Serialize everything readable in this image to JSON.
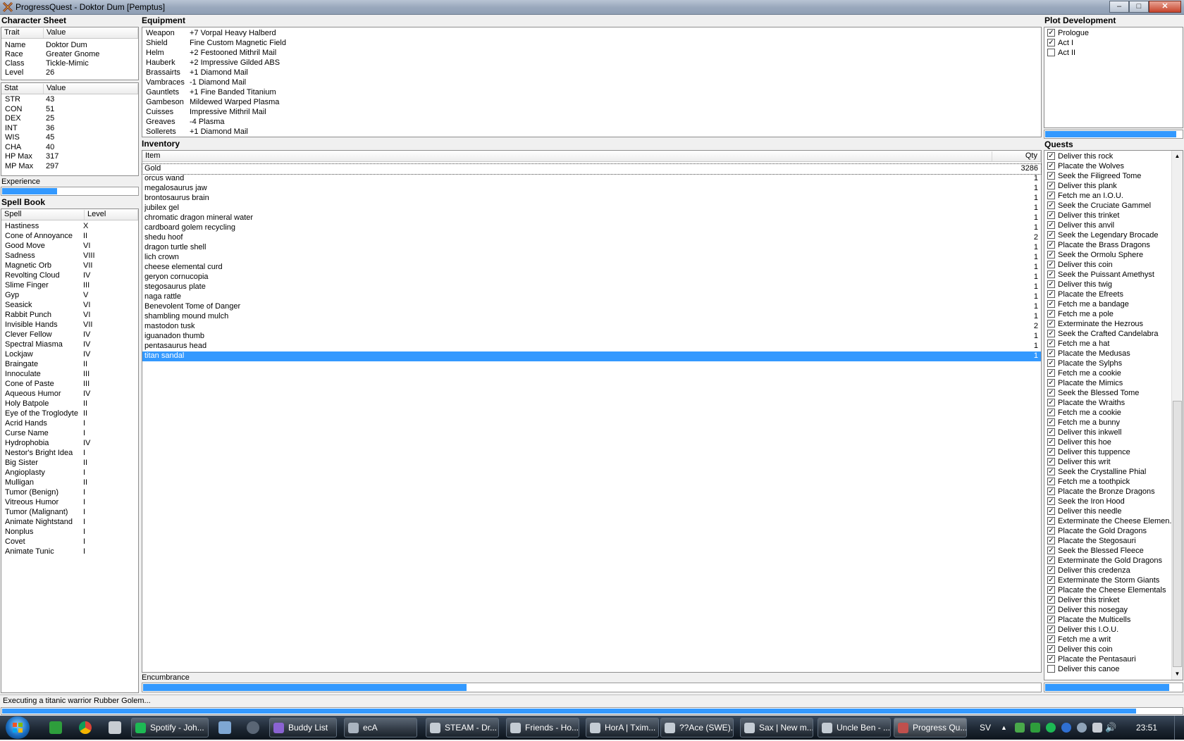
{
  "window": {
    "title": "ProgressQuest - Doktor Dum [Pemptus]",
    "minimize": "–",
    "maximize": "□",
    "close": "✕"
  },
  "character_sheet": {
    "title": "Character Sheet",
    "col_trait": "Trait",
    "col_value": "Value",
    "traits": [
      {
        "k": "Name",
        "v": "Doktor Dum"
      },
      {
        "k": "Race",
        "v": "Greater Gnome"
      },
      {
        "k": "Class",
        "v": "Tickle-Mimic"
      },
      {
        "k": "Level",
        "v": "26"
      }
    ],
    "col_stat": "Stat",
    "col_stat_value": "Value",
    "stats": [
      {
        "k": "STR",
        "v": "43"
      },
      {
        "k": "CON",
        "v": "51"
      },
      {
        "k": "DEX",
        "v": "25"
      },
      {
        "k": "INT",
        "v": "36"
      },
      {
        "k": "WIS",
        "v": "45"
      },
      {
        "k": "CHA",
        "v": "40"
      },
      {
        "k": "HP Max",
        "v": "317"
      },
      {
        "k": "MP Max",
        "v": "297"
      }
    ],
    "experience_label": "Experience",
    "experience_progress": 0.4
  },
  "spell_book": {
    "title": "Spell Book",
    "col_spell": "Spell",
    "col_level": "Level",
    "spells": [
      {
        "k": "Hastiness",
        "v": "X"
      },
      {
        "k": "Cone of Annoyance",
        "v": "II"
      },
      {
        "k": "Good Move",
        "v": "VI"
      },
      {
        "k": "Sadness",
        "v": "VIII"
      },
      {
        "k": "Magnetic Orb",
        "v": "VII"
      },
      {
        "k": "Revolting Cloud",
        "v": "IV"
      },
      {
        "k": "Slime Finger",
        "v": "III"
      },
      {
        "k": "Gyp",
        "v": "V"
      },
      {
        "k": "Seasick",
        "v": "VI"
      },
      {
        "k": "Rabbit Punch",
        "v": "VI"
      },
      {
        "k": "Invisible Hands",
        "v": "VII"
      },
      {
        "k": "Clever Fellow",
        "v": "IV"
      },
      {
        "k": "Spectral Miasma",
        "v": "IV"
      },
      {
        "k": "Lockjaw",
        "v": "IV"
      },
      {
        "k": "Braingate",
        "v": "II"
      },
      {
        "k": "Innoculate",
        "v": "III"
      },
      {
        "k": "Cone of Paste",
        "v": "III"
      },
      {
        "k": "Aqueous Humor",
        "v": "IV"
      },
      {
        "k": "Holy Batpole",
        "v": "II"
      },
      {
        "k": "Eye of the Troglodyte",
        "v": "II"
      },
      {
        "k": "Acrid Hands",
        "v": "I"
      },
      {
        "k": "Curse Name",
        "v": "I"
      },
      {
        "k": "Hydrophobia",
        "v": "IV"
      },
      {
        "k": "Nestor's Bright Idea",
        "v": "I"
      },
      {
        "k": "Big Sister",
        "v": "II"
      },
      {
        "k": "Angioplasty",
        "v": "I"
      },
      {
        "k": "Mulligan",
        "v": "II"
      },
      {
        "k": "Tumor (Benign)",
        "v": "I"
      },
      {
        "k": "Vitreous Humor",
        "v": "I"
      },
      {
        "k": "Tumor (Malignant)",
        "v": "I"
      },
      {
        "k": "Animate Nightstand",
        "v": "I"
      },
      {
        "k": "Nonplus",
        "v": "I"
      },
      {
        "k": "Covet",
        "v": "I"
      },
      {
        "k": "Animate Tunic",
        "v": "I"
      }
    ]
  },
  "equipment": {
    "title": "Equipment",
    "items": [
      {
        "k": "Weapon",
        "v": "+7 Vorpal Heavy Halberd"
      },
      {
        "k": "Shield",
        "v": "Fine Custom Magnetic Field"
      },
      {
        "k": "Helm",
        "v": "+2 Festooned Mithril Mail"
      },
      {
        "k": "Hauberk",
        "v": "+2 Impressive Gilded ABS"
      },
      {
        "k": "Brassairts",
        "v": "+1 Diamond Mail"
      },
      {
        "k": "Vambraces",
        "v": "-1 Diamond Mail"
      },
      {
        "k": "Gauntlets",
        "v": "+1 Fine Banded Titanium"
      },
      {
        "k": "Gambeson",
        "v": "Mildewed Warped Plasma"
      },
      {
        "k": "Cuisses",
        "v": "Impressive Mithril Mail"
      },
      {
        "k": "Greaves",
        "v": "-4 Plasma"
      },
      {
        "k": "Sollerets",
        "v": "+1 Diamond Mail"
      }
    ]
  },
  "inventory": {
    "title": "Inventory",
    "col_item": "Item",
    "col_qty": "Qty",
    "items": [
      {
        "k": "Gold",
        "v": "3286"
      },
      {
        "k": "orcus wand",
        "v": "1"
      },
      {
        "k": "megalosaurus jaw",
        "v": "1"
      },
      {
        "k": "brontosaurus brain",
        "v": "1"
      },
      {
        "k": "jubilex gel",
        "v": "1"
      },
      {
        "k": "chromatic dragon mineral water",
        "v": "1"
      },
      {
        "k": "cardboard golem recycling",
        "v": "1"
      },
      {
        "k": "shedu hoof",
        "v": "2"
      },
      {
        "k": "dragon turtle shell",
        "v": "1"
      },
      {
        "k": "lich crown",
        "v": "1"
      },
      {
        "k": "cheese elemental curd",
        "v": "1"
      },
      {
        "k": "geryon cornucopia",
        "v": "1"
      },
      {
        "k": "stegosaurus plate",
        "v": "1"
      },
      {
        "k": "naga rattle",
        "v": "1"
      },
      {
        "k": "Benevolent Tome of Danger",
        "v": "1"
      },
      {
        "k": "shambling mound mulch",
        "v": "1"
      },
      {
        "k": "mastodon tusk",
        "v": "2"
      },
      {
        "k": "iguanadon thumb",
        "v": "1"
      },
      {
        "k": "pentasaurus head",
        "v": "1"
      },
      {
        "k": "titan sandal",
        "v": "1"
      }
    ],
    "encumbrance_label": "Encumbrance",
    "encumbrance_progress": 0.36
  },
  "plot": {
    "title": "Plot Development",
    "acts": [
      {
        "k": "Prologue",
        "done": true
      },
      {
        "k": "Act I",
        "done": true
      },
      {
        "k": "Act II",
        "done": false
      }
    ],
    "progress": 0.95
  },
  "quests": {
    "title": "Quests",
    "items": [
      {
        "k": "Deliver this rock",
        "done": true
      },
      {
        "k": "Placate the Wolves",
        "done": true
      },
      {
        "k": "Seek the Filigreed Tome",
        "done": true
      },
      {
        "k": "Deliver this plank",
        "done": true
      },
      {
        "k": "Fetch me an I.O.U.",
        "done": true
      },
      {
        "k": "Seek the Cruciate Gammel",
        "done": true
      },
      {
        "k": "Deliver this trinket",
        "done": true
      },
      {
        "k": "Deliver this anvil",
        "done": true
      },
      {
        "k": "Seek the Legendary Brocade",
        "done": true
      },
      {
        "k": "Placate the Brass Dragons",
        "done": true
      },
      {
        "k": "Seek the Ormolu Sphere",
        "done": true
      },
      {
        "k": "Deliver this coin",
        "done": true
      },
      {
        "k": "Seek the Puissant Amethyst",
        "done": true
      },
      {
        "k": "Deliver this twig",
        "done": true
      },
      {
        "k": "Placate the Efreets",
        "done": true
      },
      {
        "k": "Fetch me a bandage",
        "done": true
      },
      {
        "k": "Fetch me a pole",
        "done": true
      },
      {
        "k": "Exterminate the Hezrous",
        "done": true
      },
      {
        "k": "Seek the Crafted Candelabra",
        "done": true
      },
      {
        "k": "Fetch me a hat",
        "done": true
      },
      {
        "k": "Placate the Medusas",
        "done": true
      },
      {
        "k": "Placate the Sylphs",
        "done": true
      },
      {
        "k": "Fetch me a cookie",
        "done": true
      },
      {
        "k": "Placate the Mimics",
        "done": true
      },
      {
        "k": "Seek the Blessed Tome",
        "done": true
      },
      {
        "k": "Placate the Wraiths",
        "done": true
      },
      {
        "k": "Fetch me a cookie",
        "done": true
      },
      {
        "k": "Fetch me a bunny",
        "done": true
      },
      {
        "k": "Deliver this inkwell",
        "done": true
      },
      {
        "k": "Deliver this hoe",
        "done": true
      },
      {
        "k": "Deliver this tuppence",
        "done": true
      },
      {
        "k": "Deliver this writ",
        "done": true
      },
      {
        "k": "Seek the Crystalline Phial",
        "done": true
      },
      {
        "k": "Fetch me a toothpick",
        "done": true
      },
      {
        "k": "Placate the Bronze Dragons",
        "done": true
      },
      {
        "k": "Seek the Iron Hood",
        "done": true
      },
      {
        "k": "Deliver this needle",
        "done": true
      },
      {
        "k": "Exterminate the Cheese Elemen...",
        "done": true
      },
      {
        "k": "Placate the Gold Dragons",
        "done": true
      },
      {
        "k": "Placate the Stegosauri",
        "done": true
      },
      {
        "k": "Seek the Blessed Fleece",
        "done": true
      },
      {
        "k": "Exterminate the Gold Dragons",
        "done": true
      },
      {
        "k": "Deliver this credenza",
        "done": true
      },
      {
        "k": "Exterminate the Storm Giants",
        "done": true
      },
      {
        "k": "Placate the Cheese Elementals",
        "done": true
      },
      {
        "k": "Deliver this trinket",
        "done": true
      },
      {
        "k": "Deliver this nosegay",
        "done": true
      },
      {
        "k": "Placate the Multicells",
        "done": true
      },
      {
        "k": "Deliver this I.O.U.",
        "done": true
      },
      {
        "k": "Fetch me a writ",
        "done": true
      },
      {
        "k": "Deliver this coin",
        "done": true
      },
      {
        "k": "Placate the Pentasauri",
        "done": true
      },
      {
        "k": "Deliver this canoe",
        "done": false
      }
    ],
    "progress": 0.9
  },
  "status": {
    "text": "Executing a titanic warrior Rubber Golem...",
    "progress": 0.96
  },
  "taskbar": {
    "buttons": [
      {
        "label": "Spotify - Joh...",
        "color": "#1db954",
        "icon": "spotify-icon"
      },
      {
        "label": "Buddy List",
        "color": "#8a63d2",
        "icon": "buddy-icon"
      },
      {
        "label": "ecA",
        "color": "#aab4c0",
        "icon": "chat-icon"
      },
      {
        "label": "STEAM - Dr...",
        "color": "#c4ccd4",
        "icon": "steam-icon"
      },
      {
        "label": "Friends - Ho...",
        "color": "#c4ccd4",
        "icon": "steam-icon"
      },
      {
        "label": "HorA | Txim...",
        "color": "#c4ccd4",
        "icon": "steam-icon"
      },
      {
        "label": "??Ace (SWE)...",
        "color": "#c4ccd4",
        "icon": "steam-icon"
      },
      {
        "label": "Sax | New m...",
        "color": "#c4ccd4",
        "icon": "steam-icon"
      },
      {
        "label": "Uncle Ben - ...",
        "color": "#c4ccd4",
        "icon": "steam-icon"
      },
      {
        "label": "Progress Qu...",
        "color": "#c0504d",
        "icon": "progressquest-icon"
      }
    ],
    "lang": "SV",
    "time": "23:51"
  }
}
